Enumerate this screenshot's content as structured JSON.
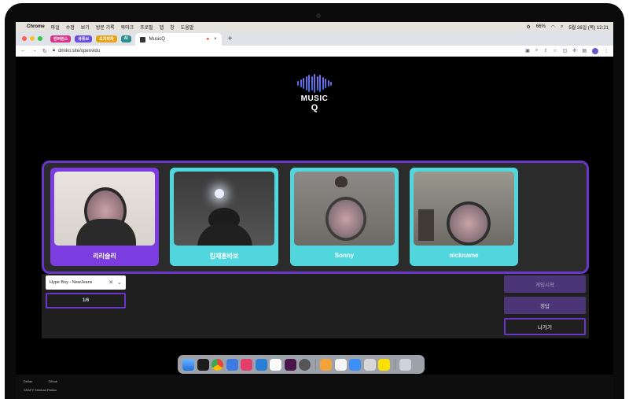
{
  "menubar": {
    "app": "Chrome",
    "items": [
      "파일",
      "수정",
      "보기",
      "방문 기록",
      "북마크",
      "프로필",
      "탭",
      "창",
      "도움말"
    ],
    "battery": "66%",
    "datetime": "5월 26일 (목) 12:21"
  },
  "tabs": {
    "groups": [
      {
        "label": "컨퍼런스",
        "color": "#d6338a"
      },
      {
        "label": "유튜브",
        "color": "#6a4ee0"
      },
      {
        "label": "도지피자",
        "color": "#e8a317"
      },
      {
        "label": "AI",
        "color": "#2b8f8f"
      }
    ],
    "active_title": "MusicQ"
  },
  "address": {
    "url": "dmiko.site/openvidu"
  },
  "logo": {
    "line1": "MUSIC",
    "line2": "Q"
  },
  "participants": [
    {
      "name": "리리슬리",
      "color": "#7c3de0"
    },
    {
      "name": "킴재훈바보",
      "color": "#52d6de"
    },
    {
      "name": "Sonny",
      "color": "#52d6de"
    },
    {
      "name": "nickname",
      "color": "#52d6de"
    }
  ],
  "controls": {
    "song_select": "Hype Boy - NewJeans",
    "count": "1/6",
    "start_label": "게임시작",
    "answer_label": "정답",
    "exit_label": "나가기"
  },
  "status": {
    "col1": "Delian",
    "col2": "Github",
    "line2": "SSAFY Shinhan Plation"
  }
}
